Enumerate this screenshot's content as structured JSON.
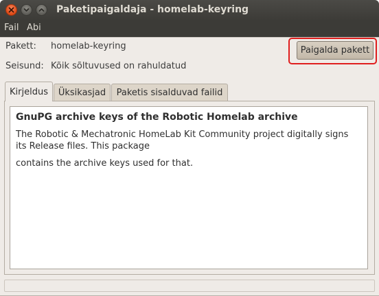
{
  "window": {
    "title": "Paketipaigaldaja - homelab-keyring"
  },
  "menubar": {
    "items": [
      {
        "label": "Fail"
      },
      {
        "label": "Abi"
      }
    ]
  },
  "info": {
    "package_label": "Pakett:",
    "package_value": "homelab-keyring",
    "status_label": "Seisund:",
    "status_value": "Kõik sõltuvused on rahuldatud"
  },
  "actions": {
    "install_label": "Paigalda pakett"
  },
  "tabs": [
    {
      "label": "Kirjeldus",
      "active": true
    },
    {
      "label": "Üksikasjad",
      "active": false
    },
    {
      "label": "Paketis sisalduvad failid",
      "active": false
    }
  ],
  "description": {
    "title": "GnuPG archive keys of the Robotic Homelab archive",
    "paragraphs": [
      "The Robotic & Mechatronic HomeLab Kit Community project digitally signs its Release files. This package",
      "contains the archive keys used for that."
    ]
  },
  "colors": {
    "titlebar": "#3c3b37",
    "window_bg": "#efebe7",
    "close_button": "#df4a16",
    "highlight": "#e01d1d"
  },
  "icons": {
    "close": "close-icon",
    "minimize": "minimize-icon",
    "maximize": "maximize-icon"
  }
}
